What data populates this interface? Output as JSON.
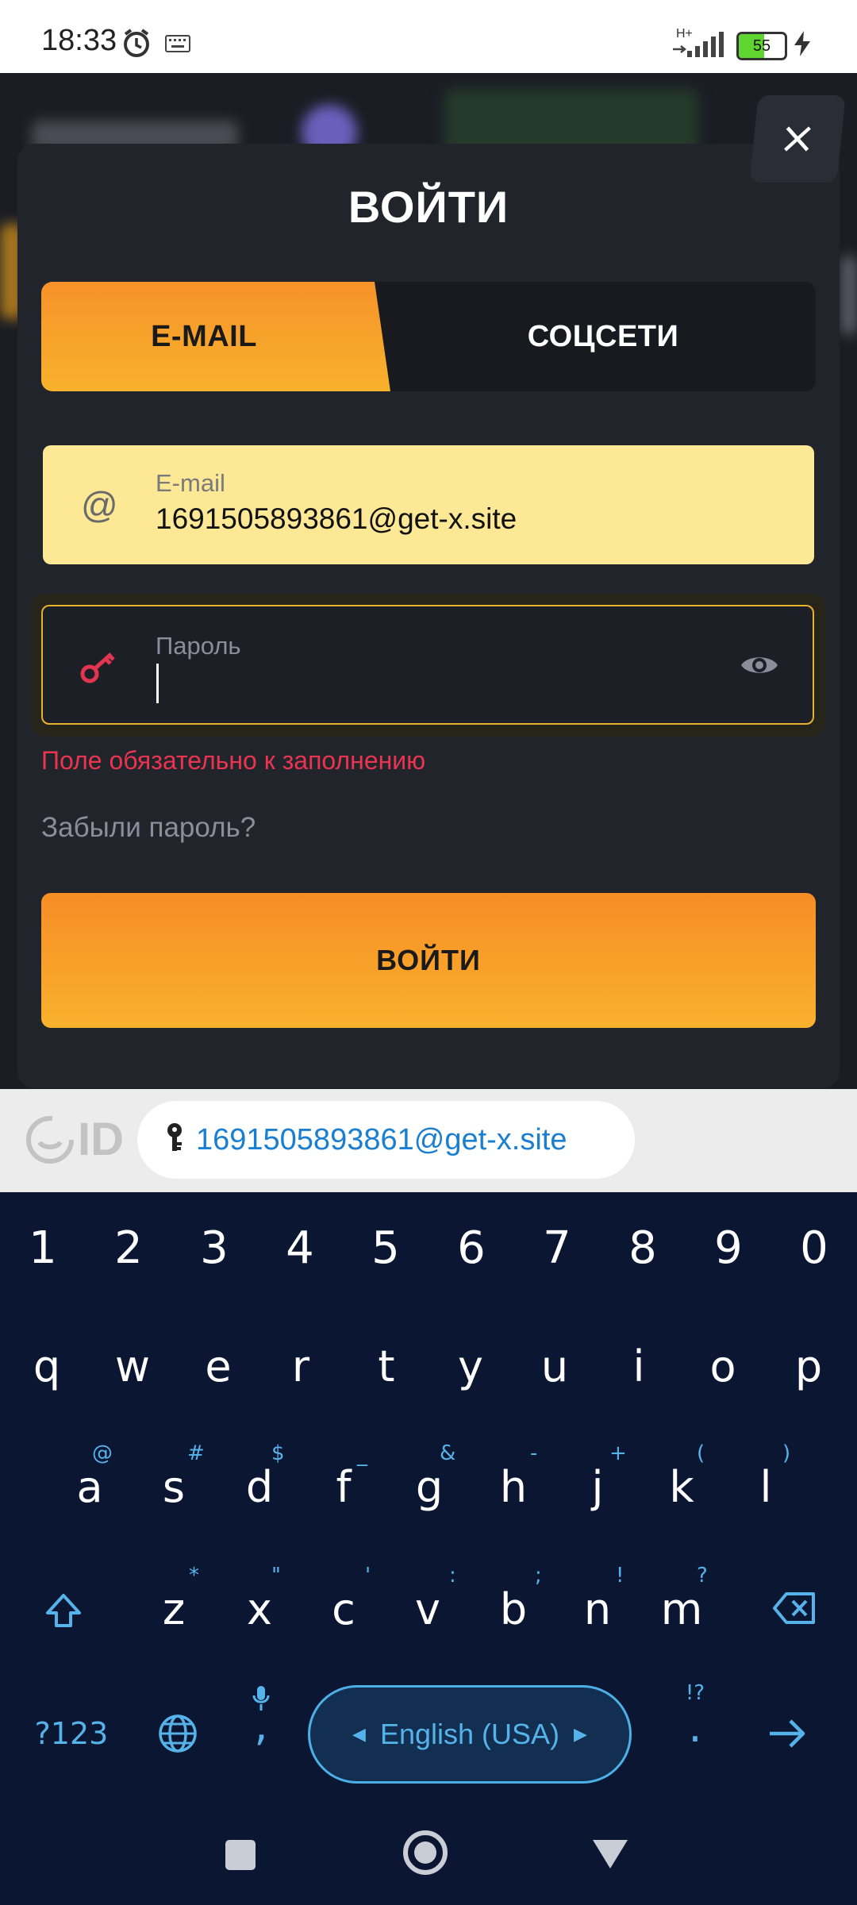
{
  "status_bar": {
    "time": "18:33",
    "network": "H+",
    "battery": "55",
    "icons": [
      "alarm-icon",
      "keyboard-icon",
      "signal-icon",
      "battery-icon",
      "charging-icon"
    ]
  },
  "modal": {
    "title": "ВОЙТИ",
    "tabs": [
      {
        "label": "E-MAIL",
        "active": true
      },
      {
        "label": "СОЦСЕТИ",
        "active": false
      }
    ],
    "email": {
      "label": "E-mail",
      "value": "1691505893861@get-x.site"
    },
    "password": {
      "label": "Пароль",
      "value": ""
    },
    "error": "Поле обязательно к заполнению",
    "forgot": "Забыли пароль?",
    "submit": "ВОЙТИ",
    "colors": {
      "accent": "#f8a52a",
      "error": "#ea3450",
      "email_bg": "#fde896"
    }
  },
  "autofill": {
    "logo": "ID",
    "suggestion": "1691505893861@get-x.site"
  },
  "keyboard": {
    "numbers": [
      "1",
      "2",
      "3",
      "4",
      "5",
      "6",
      "7",
      "8",
      "9",
      "0"
    ],
    "row1": [
      "q",
      "w",
      "e",
      "r",
      "t",
      "y",
      "u",
      "i",
      "o",
      "p"
    ],
    "row2": [
      {
        "k": "a",
        "h": "@"
      },
      {
        "k": "s",
        "h": "#"
      },
      {
        "k": "d",
        "h": "$"
      },
      {
        "k": "f",
        "h": "_"
      },
      {
        "k": "g",
        "h": "&"
      },
      {
        "k": "h",
        "h": "-"
      },
      {
        "k": "j",
        "h": "+"
      },
      {
        "k": "k",
        "h": "("
      },
      {
        "k": "l",
        "h": ")"
      }
    ],
    "row3": [
      {
        "k": "z",
        "h": "*"
      },
      {
        "k": "x",
        "h": "\""
      },
      {
        "k": "c",
        "h": "'"
      },
      {
        "k": "v",
        "h": ":"
      },
      {
        "k": "b",
        "h": ";"
      },
      {
        "k": "n",
        "h": "!"
      },
      {
        "k": "m",
        "h": "?"
      }
    ],
    "symbols_key": "?123",
    "comma": ",",
    "period": ".",
    "period_hint": "!?",
    "language": "English (USA)"
  }
}
